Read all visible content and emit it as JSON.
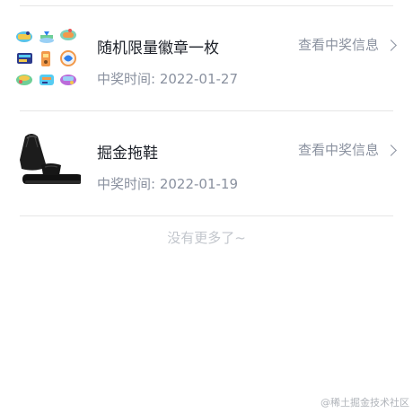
{
  "prizes": [
    {
      "name": "随机限量徽章一枚",
      "time": "中奖时间: 2022-01-27",
      "detail_label": "查看中奖信息",
      "thumb_icon": "badges-icon"
    },
    {
      "name": "掘金拖鞋",
      "time": "中奖时间: 2022-01-19",
      "detail_label": "查看中奖信息",
      "thumb_icon": "slippers-icon"
    }
  ],
  "end_text": "没有更多了~",
  "watermark": "@稀土掘金技术社区",
  "colors": {
    "title": "#1d2129",
    "secondary": "#8a919f",
    "muted": "#c2c6cc",
    "divider": "#e6e6e6"
  }
}
